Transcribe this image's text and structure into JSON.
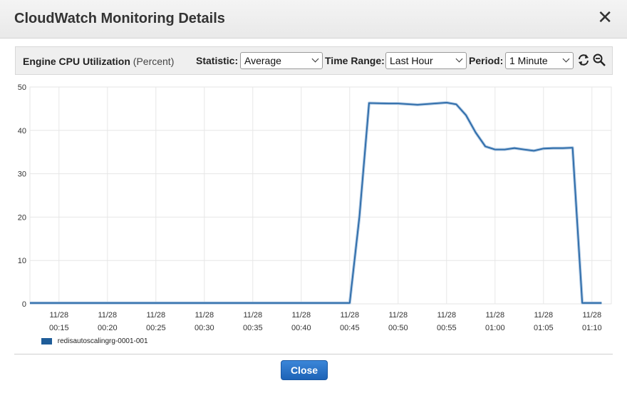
{
  "dialog": {
    "title": "CloudWatch Monitoring Details",
    "close_icon": "close-icon"
  },
  "toolbar": {
    "metric_name": "Engine CPU Utilization",
    "metric_unit": "(Percent)",
    "statistic_label": "Statistic:",
    "statistic_value": "Average",
    "time_range_label": "Time Range:",
    "time_range_value": "Last Hour",
    "period_label": "Period:",
    "period_value": "1 Minute",
    "refresh_icon": "refresh-icon",
    "zoom_icon": "zoom-out-icon"
  },
  "footer": {
    "close_label": "Close"
  },
  "colors": {
    "series": "#2b6aa8",
    "grid": "#e6e6e6",
    "button": "#2a74c9"
  },
  "chart_data": {
    "type": "line",
    "title": "",
    "xlabel": "",
    "ylabel": "",
    "ylim": [
      0,
      50
    ],
    "xlim": [
      "11/28 00:12",
      "11/28 01:12"
    ],
    "y_ticks": [
      0,
      10,
      20,
      30,
      40,
      50
    ],
    "x_ticks": [
      {
        "date": "11/28",
        "time": "00:15"
      },
      {
        "date": "11/28",
        "time": "00:20"
      },
      {
        "date": "11/28",
        "time": "00:25"
      },
      {
        "date": "11/28",
        "time": "00:30"
      },
      {
        "date": "11/28",
        "time": "00:35"
      },
      {
        "date": "11/28",
        "time": "00:40"
      },
      {
        "date": "11/28",
        "time": "00:45"
      },
      {
        "date": "11/28",
        "time": "00:50"
      },
      {
        "date": "11/28",
        "time": "00:55"
      },
      {
        "date": "11/28",
        "time": "01:00"
      },
      {
        "date": "11/28",
        "time": "01:05"
      },
      {
        "date": "11/28",
        "time": "01:10"
      }
    ],
    "grid": true,
    "legend_position": "bottom-left",
    "series": [
      {
        "name": "redisautoscalingrg-0001-001",
        "x": [
          "00:12",
          "00:20",
          "00:30",
          "00:40",
          "00:45",
          "00:46",
          "00:47",
          "00:49",
          "00:50",
          "00:52",
          "00:55",
          "00:56",
          "00:57",
          "00:58",
          "00:59",
          "01:00",
          "01:01",
          "01:02",
          "01:03",
          "01:04",
          "01:05",
          "01:06",
          "01:07",
          "01:08",
          "01:09",
          "01:10",
          "01:11"
        ],
        "values": [
          0.2,
          0.2,
          0.2,
          0.2,
          0.2,
          20,
          46.3,
          46.2,
          46.2,
          45.9,
          46.4,
          46,
          43.5,
          39.5,
          36.3,
          35.6,
          35.6,
          35.9,
          35.6,
          35.3,
          35.8,
          35.9,
          35.9,
          36,
          0.2,
          0.2,
          0.2
        ]
      }
    ]
  }
}
